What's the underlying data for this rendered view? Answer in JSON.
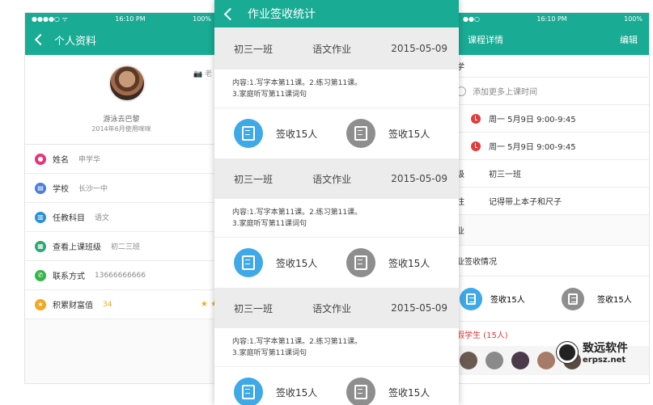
{
  "status": {
    "time": "16:10 PM",
    "battery": "100%"
  },
  "left": {
    "title": "个人资料",
    "camera_label": "老",
    "name": "游泳去巴黎",
    "joined": "2014年6月使用咪咪",
    "rows": [
      {
        "label": "姓名",
        "value": "申学华",
        "color": "#e8347a"
      },
      {
        "label": "学校",
        "value": "长沙一中",
        "color": "#4a7ee0"
      },
      {
        "label": "任教科目",
        "value": "语文",
        "color": "#2d8fd6"
      },
      {
        "label": "查看上课班级",
        "value": "初二三班",
        "color": "#2aa876"
      },
      {
        "label": "联系方式",
        "value": "13666666666",
        "color": "#36b54a"
      },
      {
        "label": "积累财富值",
        "value": "34",
        "color": "#f3a81e"
      }
    ],
    "stars": "★ ★"
  },
  "middle": {
    "title": "作业签收统计",
    "groups": [
      {
        "class": "初三一班",
        "type": "语文作业",
        "date": "2015-05-09",
        "content1": "内容:1.写字本第11课。2.练习第11课。",
        "content2": "3.家庭听写第11课词句",
        "signed": "签收15人",
        "unsigned": "签收15人"
      },
      {
        "class": "初三一班",
        "type": "语文作业",
        "date": "2015-05-09",
        "content1": "内容:1.写字本第11课。2.练习第11课。",
        "content2": "3.家庭听写第11课词句",
        "signed": "签收15人",
        "unsigned": "签收15人"
      },
      {
        "class": "初三一班",
        "type": "语文作业",
        "date": "2015-05-09",
        "content1": "内容:1.写字本第11课。2.练习第11课。",
        "content2": "3.家庭听写第11课词句",
        "signed": "签收15人",
        "unsigned": "签收15人"
      }
    ]
  },
  "right": {
    "title": "课程详情",
    "edit": "编辑",
    "section1": "学",
    "add_time": "添加更多上课时间",
    "time1": "周一  5月9日  9:00-9:45",
    "time2": "周一  5月9日  9:00-9:45",
    "class_label": "级",
    "class_value": "初三一班",
    "note_label": "注",
    "note_value": "记得带上本子和尺子",
    "section2": "业",
    "section3": "业签收情况",
    "signed": "签收15人",
    "unsigned": "签收15人",
    "leave": "假学生 (15人)"
  },
  "logo": {
    "name": "致远软件",
    "url": "erpsz.net"
  }
}
